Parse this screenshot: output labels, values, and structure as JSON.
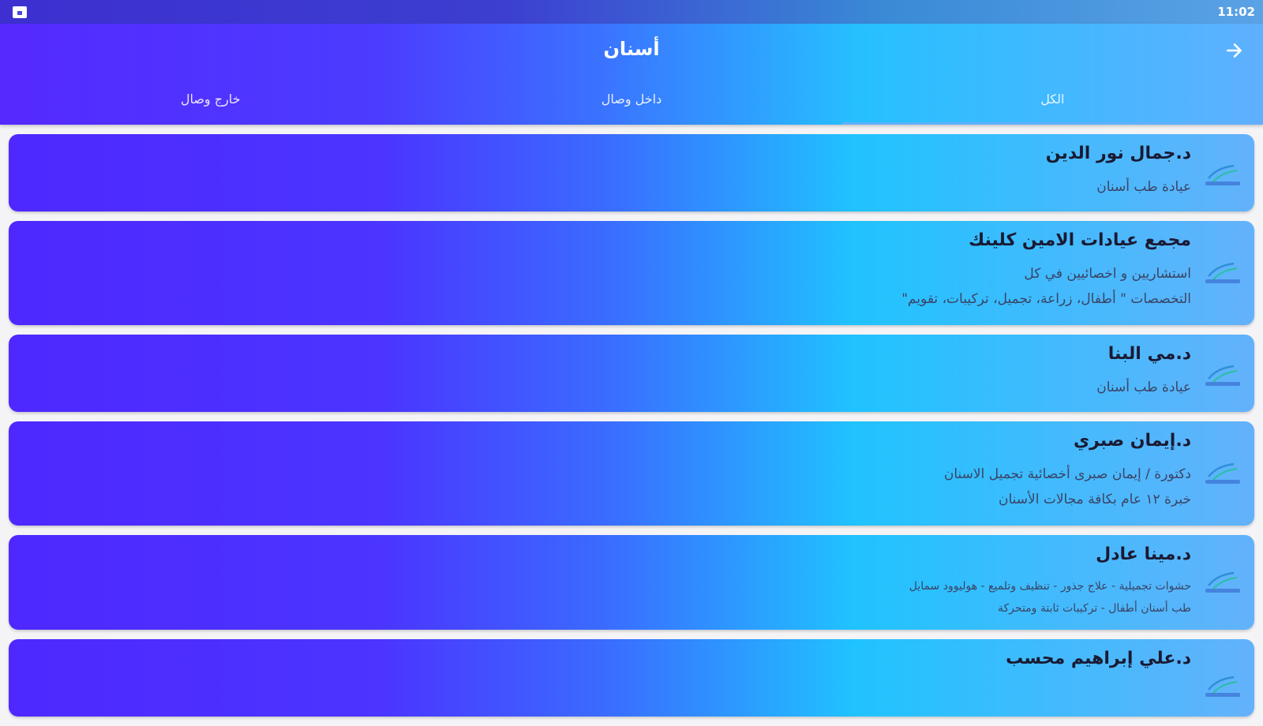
{
  "status_bar": {
    "time": "11:02"
  },
  "app_bar": {
    "title": "أسنان"
  },
  "tabs": [
    {
      "label": "الكل",
      "active": true
    },
    {
      "label": "داخل وصال",
      "active": false
    },
    {
      "label": "خارج وصال",
      "active": false
    }
  ],
  "cards": [
    {
      "name": "د.جمال نور الدين",
      "description": "عيادة طب أسنان"
    },
    {
      "name": "مجمع عيادات الامين كلينك",
      "description": "استشاريين و اخصائيين في كل\nالتخصصات \" أطفال، زراعة، تجميل، تركيبات، تقويم\""
    },
    {
      "name": "د.مي البنا",
      "description": "عيادة طب أسنان"
    },
    {
      "name": "د.إيمان صبري",
      "description": "دكتورة / إيمان صبرى أخصائية تجميل الاسنان\nخبرة ١٢ عام بكافة مجالات الأسنان"
    },
    {
      "name": "د.مينا عادل",
      "description": "حشوات تجميلية - علاج جذور - تنظيف وتلميع - هوليوود سمايل\nطب أسنان أطفال - تركيبات ثابتة ومتحركة"
    },
    {
      "name": "د.علي إبراهيم محسب",
      "description": ""
    }
  ],
  "colors": {
    "gradient_start": "#4e28ff",
    "gradient_mid": "#20c3ff",
    "gradient_end": "#63b2fb"
  },
  "icons": {
    "back": "arrow-right-icon",
    "card_logo": "wesal-logo-icon",
    "status": "gallery-icon"
  }
}
